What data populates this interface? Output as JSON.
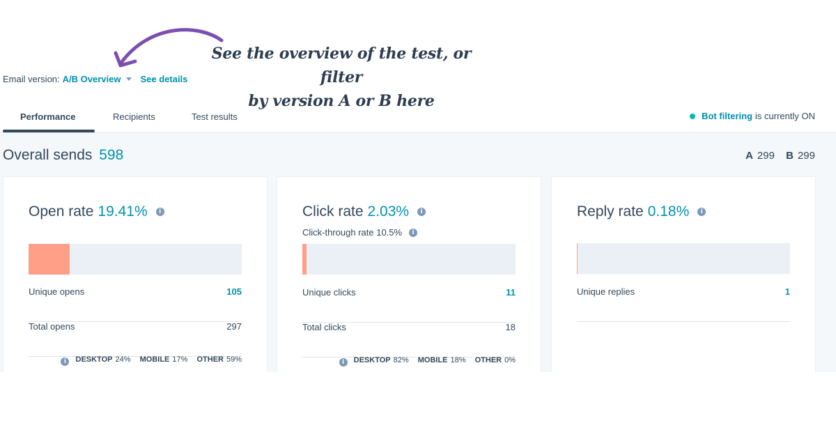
{
  "annotation": {
    "line1": "See the overview of the test, or filter",
    "line2": "by version A or B here"
  },
  "version": {
    "label": "Email version:",
    "value": "A/B Overview",
    "details": "See details"
  },
  "tabs": [
    {
      "label": "Performance",
      "active": true
    },
    {
      "label": "Recipients"
    },
    {
      "label": "Test results"
    }
  ],
  "bot": {
    "link": "Bot filtering",
    "status": "is currently ON"
  },
  "sends": {
    "label": "Overall sends",
    "value": "598",
    "a_label": "A",
    "a_value": "299",
    "b_label": "B",
    "b_value": "299"
  },
  "cards": [
    {
      "title": "Open rate",
      "pct": "19.41%",
      "fill_fraction": 0.1941,
      "rows": [
        {
          "label": "Unique opens",
          "value": "105"
        },
        {
          "label": "Total opens",
          "value": "297"
        }
      ],
      "devices": {
        "desktop_label": "DESKTOP",
        "desktop": "24%",
        "mobile_label": "MOBILE",
        "mobile": "17%",
        "other_label": "OTHER",
        "other": "59%"
      }
    },
    {
      "title": "Click rate",
      "pct": "2.03%",
      "fill_fraction": 0.0203,
      "subtitle": "Click-through rate 10.5%",
      "rows": [
        {
          "label": "Unique clicks",
          "value": "11"
        },
        {
          "label": "Total clicks",
          "value": "18"
        }
      ],
      "devices": {
        "desktop_label": "DESKTOP",
        "desktop": "82%",
        "mobile_label": "MOBILE",
        "mobile": "18%",
        "other_label": "OTHER",
        "other": "0%"
      }
    },
    {
      "title": "Reply rate",
      "pct": "0.18%",
      "fill_fraction": 0.0018,
      "rows": [
        {
          "label": "Unique replies",
          "value": "1"
        }
      ]
    }
  ],
  "colors": {
    "accent": "#0091ae",
    "bar_fill": "#ff9f87",
    "bar_track": "#eaf0f6",
    "status_dot": "#00bda5",
    "arrow": "#7b4fb0"
  },
  "icons": {
    "info": "info-circle-icon",
    "caret": "caret-down-icon",
    "arrow": "curved-arrow-icon",
    "status": "status-dot-icon"
  }
}
